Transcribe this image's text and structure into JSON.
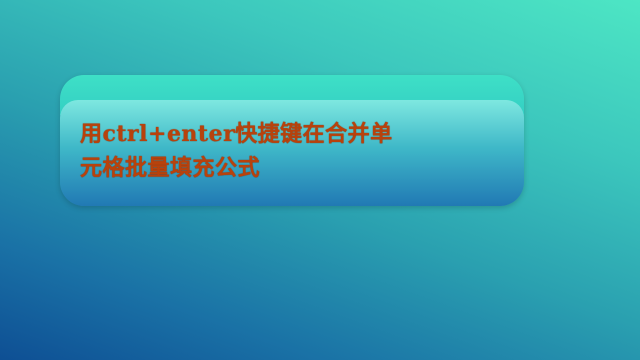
{
  "slide": {
    "title_line1": "用ctrl+enter快捷键在合并单",
    "title_line2": "元格批量填充公式"
  }
}
